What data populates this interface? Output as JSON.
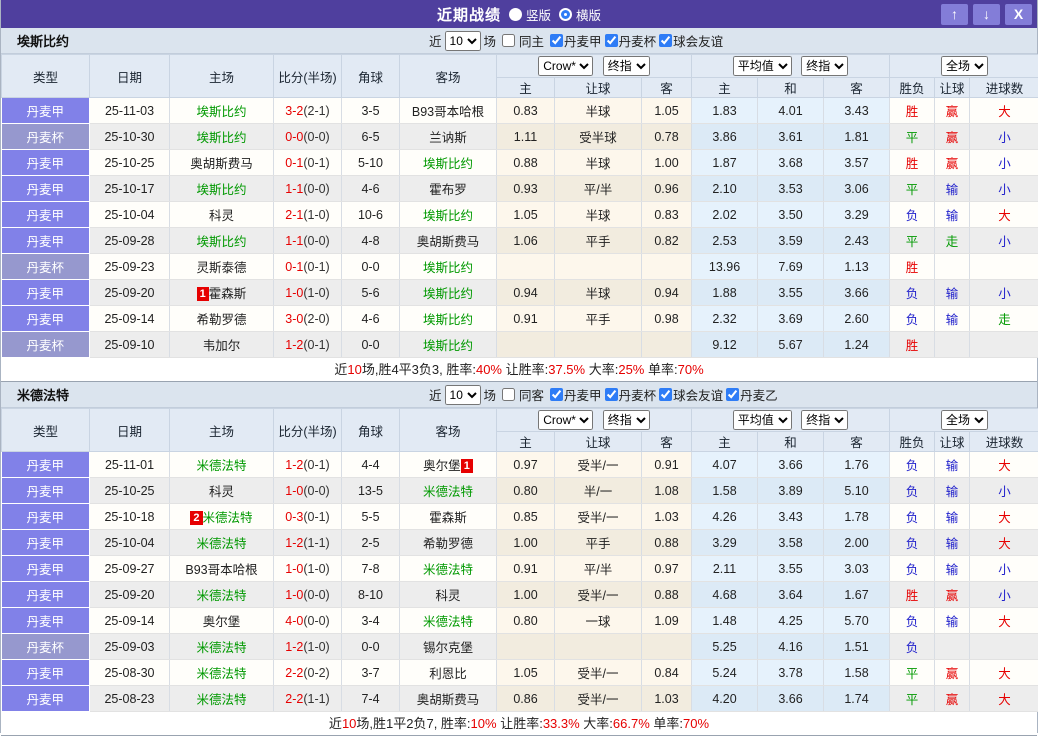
{
  "titlebar": {
    "title": "近期战绩",
    "radios": [
      {
        "label": "竖版",
        "selected": false
      },
      {
        "label": "横版",
        "selected": true
      }
    ],
    "up_button": "↑",
    "down_button": "↓",
    "close_button": "X"
  },
  "colors": {
    "titlebar_bg": "#4f3f9e",
    "titlebar_button_bg": "#837dd8",
    "league_primary_bg": "#8181e8",
    "league_cup_bg": "#9698ce",
    "win_red": "#e60000",
    "draw_green": "#009900",
    "loss_blue": "#2222cc",
    "team_green": "#009900"
  },
  "table_header": {
    "type": "类型",
    "date": "日期",
    "home": "主场",
    "score": "比分(半场)",
    "corner": "角球",
    "away": "客场",
    "crow_select": "Crow*",
    "final_select": "终指",
    "avg_select": "平均值",
    "fulltime_select": "全场",
    "sub_home": "主",
    "sub_handicap": "让球",
    "sub_away": "客",
    "sub_draw": "和",
    "res_winloss": "胜负",
    "res_handicap": "让球",
    "res_goals": "进球数"
  },
  "filter_common": {
    "near": "近",
    "games": "10",
    "games_suffix": "场"
  },
  "sections": [
    {
      "team": "埃斯比约",
      "same_label": "同主",
      "same_checked": false,
      "leagues": [
        {
          "label": "丹麦甲",
          "checked": true
        },
        {
          "label": "丹麦杯",
          "checked": true
        },
        {
          "label": "球会友谊",
          "checked": true
        }
      ],
      "rows": [
        {
          "lg": "丹麦甲",
          "cup": false,
          "date": "25-11-03",
          "hb": "",
          "home": "埃斯比约",
          "hg": true,
          "score": "3-2",
          "half": "(2-1)",
          "cr": "3-5",
          "away": "B93哥本哈根",
          "ag": false,
          "ab": "",
          "c1": "0.83",
          "c2": "半球",
          "c3": "1.05",
          "m1": "1.83",
          "m2": "4.01",
          "m3": "3.43",
          "w": "胜",
          "wc": "r",
          "h": "赢",
          "hc": "r",
          "g": "大",
          "gc": "r"
        },
        {
          "lg": "丹麦杯",
          "cup": true,
          "date": "25-10-30",
          "hb": "",
          "home": "埃斯比约",
          "hg": true,
          "score": "0-0",
          "half": "(0-0)",
          "cr": "6-5",
          "away": "兰讷斯",
          "ag": false,
          "ab": "",
          "c1": "1.11",
          "c2": "受半球",
          "c3": "0.78",
          "m1": "3.86",
          "m2": "3.61",
          "m3": "1.81",
          "w": "平",
          "wc": "g",
          "h": "赢",
          "hc": "r",
          "g": "小",
          "gc": "b"
        },
        {
          "lg": "丹麦甲",
          "cup": false,
          "date": "25-10-25",
          "hb": "",
          "home": "奥胡斯费马",
          "hg": false,
          "score": "0-1",
          "half": "(0-1)",
          "cr": "5-10",
          "away": "埃斯比约",
          "ag": true,
          "ab": "",
          "c1": "0.88",
          "c2": "半球",
          "c3": "1.00",
          "m1": "1.87",
          "m2": "3.68",
          "m3": "3.57",
          "w": "胜",
          "wc": "r",
          "h": "赢",
          "hc": "r",
          "g": "小",
          "gc": "b"
        },
        {
          "lg": "丹麦甲",
          "cup": false,
          "date": "25-10-17",
          "hb": "",
          "home": "埃斯比约",
          "hg": true,
          "score": "1-1",
          "half": "(0-0)",
          "cr": "4-6",
          "away": "霍布罗",
          "ag": false,
          "ab": "",
          "c1": "0.93",
          "c2": "平/半",
          "c3": "0.96",
          "m1": "2.10",
          "m2": "3.53",
          "m3": "3.06",
          "w": "平",
          "wc": "g",
          "h": "输",
          "hc": "b",
          "g": "小",
          "gc": "b"
        },
        {
          "lg": "丹麦甲",
          "cup": false,
          "date": "25-10-04",
          "hb": "",
          "home": "科灵",
          "hg": false,
          "score": "2-1",
          "half": "(1-0)",
          "cr": "10-6",
          "away": "埃斯比约",
          "ag": true,
          "ab": "",
          "c1": "1.05",
          "c2": "半球",
          "c3": "0.83",
          "m1": "2.02",
          "m2": "3.50",
          "m3": "3.29",
          "w": "负",
          "wc": "b",
          "h": "输",
          "hc": "b",
          "g": "大",
          "gc": "r"
        },
        {
          "lg": "丹麦甲",
          "cup": false,
          "date": "25-09-28",
          "hb": "",
          "home": "埃斯比约",
          "hg": true,
          "score": "1-1",
          "half": "(0-0)",
          "cr": "4-8",
          "away": "奥胡斯费马",
          "ag": false,
          "ab": "",
          "c1": "1.06",
          "c2": "平手",
          "c3": "0.82",
          "m1": "2.53",
          "m2": "3.59",
          "m3": "2.43",
          "w": "平",
          "wc": "g",
          "h": "走",
          "hc": "g",
          "g": "小",
          "gc": "b"
        },
        {
          "lg": "丹麦杯",
          "cup": true,
          "date": "25-09-23",
          "hb": "",
          "home": "灵斯泰德",
          "hg": false,
          "score": "0-1",
          "half": "(0-1)",
          "cr": "0-0",
          "away": "埃斯比约",
          "ag": true,
          "ab": "",
          "c1": "",
          "c2": "",
          "c3": "",
          "m1": "13.96",
          "m2": "7.69",
          "m3": "1.13",
          "w": "胜",
          "wc": "r",
          "h": "",
          "hc": "",
          "g": "",
          "gc": ""
        },
        {
          "lg": "丹麦甲",
          "cup": false,
          "date": "25-09-20",
          "hb": "1",
          "home": "霍森斯",
          "hg": false,
          "score": "1-0",
          "half": "(1-0)",
          "cr": "5-6",
          "away": "埃斯比约",
          "ag": true,
          "ab": "",
          "c1": "0.94",
          "c2": "半球",
          "c3": "0.94",
          "m1": "1.88",
          "m2": "3.55",
          "m3": "3.66",
          "w": "负",
          "wc": "b",
          "h": "输",
          "hc": "b",
          "g": "小",
          "gc": "b"
        },
        {
          "lg": "丹麦甲",
          "cup": false,
          "date": "25-09-14",
          "hb": "",
          "home": "希勒罗德",
          "hg": false,
          "score": "3-0",
          "half": "(2-0)",
          "cr": "4-6",
          "away": "埃斯比约",
          "ag": true,
          "ab": "",
          "c1": "0.91",
          "c2": "平手",
          "c3": "0.98",
          "m1": "2.32",
          "m2": "3.69",
          "m3": "2.60",
          "w": "负",
          "wc": "b",
          "h": "输",
          "hc": "b",
          "g": "走",
          "gc": "g"
        },
        {
          "lg": "丹麦杯",
          "cup": true,
          "date": "25-09-10",
          "hb": "",
          "home": "韦加尔",
          "hg": false,
          "score": "1-2",
          "half": "(0-1)",
          "cr": "0-0",
          "away": "埃斯比约",
          "ag": true,
          "ab": "",
          "c1": "",
          "c2": "",
          "c3": "",
          "m1": "9.12",
          "m2": "5.67",
          "m3": "1.24",
          "w": "胜",
          "wc": "r",
          "h": "",
          "hc": "",
          "g": "",
          "gc": ""
        }
      ],
      "summary": [
        {
          "t": "近",
          "c": "k"
        },
        {
          "t": "10",
          "c": "r"
        },
        {
          "t": "场,胜4平3负3, 胜率:",
          "c": "k"
        },
        {
          "t": "40%",
          "c": "r"
        },
        {
          "t": " 让胜率:",
          "c": "k"
        },
        {
          "t": "37.5%",
          "c": "r"
        },
        {
          "t": " 大率:",
          "c": "k"
        },
        {
          "t": "25%",
          "c": "r"
        },
        {
          "t": " 单率:",
          "c": "k"
        },
        {
          "t": "70%",
          "c": "r"
        }
      ]
    },
    {
      "team": "米德法特",
      "same_label": "同客",
      "same_checked": false,
      "leagues": [
        {
          "label": "丹麦甲",
          "checked": true
        },
        {
          "label": "丹麦杯",
          "checked": true
        },
        {
          "label": "球会友谊",
          "checked": true
        },
        {
          "label": "丹麦乙",
          "checked": true
        }
      ],
      "rows": [
        {
          "lg": "丹麦甲",
          "cup": false,
          "date": "25-11-01",
          "hb": "",
          "home": "米德法特",
          "hg": true,
          "score": "1-2",
          "half": "(0-1)",
          "cr": "4-4",
          "away": "奥尔堡",
          "ag": false,
          "ab": "1",
          "c1": "0.97",
          "c2": "受半/一",
          "c3": "0.91",
          "m1": "4.07",
          "m2": "3.66",
          "m3": "1.76",
          "w": "负",
          "wc": "b",
          "h": "输",
          "hc": "b",
          "g": "大",
          "gc": "r"
        },
        {
          "lg": "丹麦甲",
          "cup": false,
          "date": "25-10-25",
          "hb": "",
          "home": "科灵",
          "hg": false,
          "score": "1-0",
          "half": "(0-0)",
          "cr": "13-5",
          "away": "米德法特",
          "ag": true,
          "ab": "",
          "c1": "0.80",
          "c2": "半/一",
          "c3": "1.08",
          "m1": "1.58",
          "m2": "3.89",
          "m3": "5.10",
          "w": "负",
          "wc": "b",
          "h": "输",
          "hc": "b",
          "g": "小",
          "gc": "b"
        },
        {
          "lg": "丹麦甲",
          "cup": false,
          "date": "25-10-18",
          "hb": "2",
          "home": "米德法特",
          "hg": true,
          "score": "0-3",
          "half": "(0-1)",
          "cr": "5-5",
          "away": "霍森斯",
          "ag": false,
          "ab": "",
          "c1": "0.85",
          "c2": "受半/一",
          "c3": "1.03",
          "m1": "4.26",
          "m2": "3.43",
          "m3": "1.78",
          "w": "负",
          "wc": "b",
          "h": "输",
          "hc": "b",
          "g": "大",
          "gc": "r"
        },
        {
          "lg": "丹麦甲",
          "cup": false,
          "date": "25-10-04",
          "hb": "",
          "home": "米德法特",
          "hg": true,
          "score": "1-2",
          "half": "(1-1)",
          "cr": "2-5",
          "away": "希勒罗德",
          "ag": false,
          "ab": "",
          "c1": "1.00",
          "c2": "平手",
          "c3": "0.88",
          "m1": "3.29",
          "m2": "3.58",
          "m3": "2.00",
          "w": "负",
          "wc": "b",
          "h": "输",
          "hc": "b",
          "g": "大",
          "gc": "r"
        },
        {
          "lg": "丹麦甲",
          "cup": false,
          "date": "25-09-27",
          "hb": "",
          "home": "B93哥本哈根",
          "hg": false,
          "score": "1-0",
          "half": "(1-0)",
          "cr": "7-8",
          "away": "米德法特",
          "ag": true,
          "ab": "",
          "c1": "0.91",
          "c2": "平/半",
          "c3": "0.97",
          "m1": "2.11",
          "m2": "3.55",
          "m3": "3.03",
          "w": "负",
          "wc": "b",
          "h": "输",
          "hc": "b",
          "g": "小",
          "gc": "b"
        },
        {
          "lg": "丹麦甲",
          "cup": false,
          "date": "25-09-20",
          "hb": "",
          "home": "米德法特",
          "hg": true,
          "score": "1-0",
          "half": "(0-0)",
          "cr": "8-10",
          "away": "科灵",
          "ag": false,
          "ab": "",
          "c1": "1.00",
          "c2": "受半/一",
          "c3": "0.88",
          "m1": "4.68",
          "m2": "3.64",
          "m3": "1.67",
          "w": "胜",
          "wc": "r",
          "h": "赢",
          "hc": "r",
          "g": "小",
          "gc": "b"
        },
        {
          "lg": "丹麦甲",
          "cup": false,
          "date": "25-09-14",
          "hb": "",
          "home": "奥尔堡",
          "hg": false,
          "score": "4-0",
          "half": "(0-0)",
          "cr": "3-4",
          "away": "米德法特",
          "ag": true,
          "ab": "",
          "c1": "0.80",
          "c2": "一球",
          "c3": "1.09",
          "m1": "1.48",
          "m2": "4.25",
          "m3": "5.70",
          "w": "负",
          "wc": "b",
          "h": "输",
          "hc": "b",
          "g": "大",
          "gc": "r"
        },
        {
          "lg": "丹麦杯",
          "cup": true,
          "date": "25-09-03",
          "hb": "",
          "home": "米德法特",
          "hg": true,
          "score": "1-2",
          "half": "(1-0)",
          "cr": "0-0",
          "away": "锡尔克堡",
          "ag": false,
          "ab": "",
          "c1": "",
          "c2": "",
          "c3": "",
          "m1": "5.25",
          "m2": "4.16",
          "m3": "1.51",
          "w": "负",
          "wc": "b",
          "h": "",
          "hc": "",
          "g": "",
          "gc": ""
        },
        {
          "lg": "丹麦甲",
          "cup": false,
          "date": "25-08-30",
          "hb": "",
          "home": "米德法特",
          "hg": true,
          "score": "2-2",
          "half": "(0-2)",
          "cr": "3-7",
          "away": "利恩比",
          "ag": false,
          "ab": "",
          "c1": "1.05",
          "c2": "受半/一",
          "c3": "0.84",
          "m1": "5.24",
          "m2": "3.78",
          "m3": "1.58",
          "w": "平",
          "wc": "g",
          "h": "赢",
          "hc": "r",
          "g": "大",
          "gc": "r"
        },
        {
          "lg": "丹麦甲",
          "cup": false,
          "date": "25-08-23",
          "hb": "",
          "home": "米德法特",
          "hg": true,
          "score": "2-2",
          "half": "(1-1)",
          "cr": "7-4",
          "away": "奥胡斯费马",
          "ag": false,
          "ab": "",
          "c1": "0.86",
          "c2": "受半/一",
          "c3": "1.03",
          "m1": "4.20",
          "m2": "3.66",
          "m3": "1.74",
          "w": "平",
          "wc": "g",
          "h": "赢",
          "hc": "r",
          "g": "大",
          "gc": "r"
        }
      ],
      "summary": [
        {
          "t": "近",
          "c": "k"
        },
        {
          "t": "10",
          "c": "r"
        },
        {
          "t": "场,胜1平2负7, 胜率:",
          "c": "k"
        },
        {
          "t": "10%",
          "c": "r"
        },
        {
          "t": " 让胜率:",
          "c": "k"
        },
        {
          "t": "33.3%",
          "c": "r"
        },
        {
          "t": " 大率:",
          "c": "k"
        },
        {
          "t": "66.7%",
          "c": "r"
        },
        {
          "t": " 单率:",
          "c": "k"
        },
        {
          "t": "70%",
          "c": "r"
        }
      ]
    }
  ]
}
